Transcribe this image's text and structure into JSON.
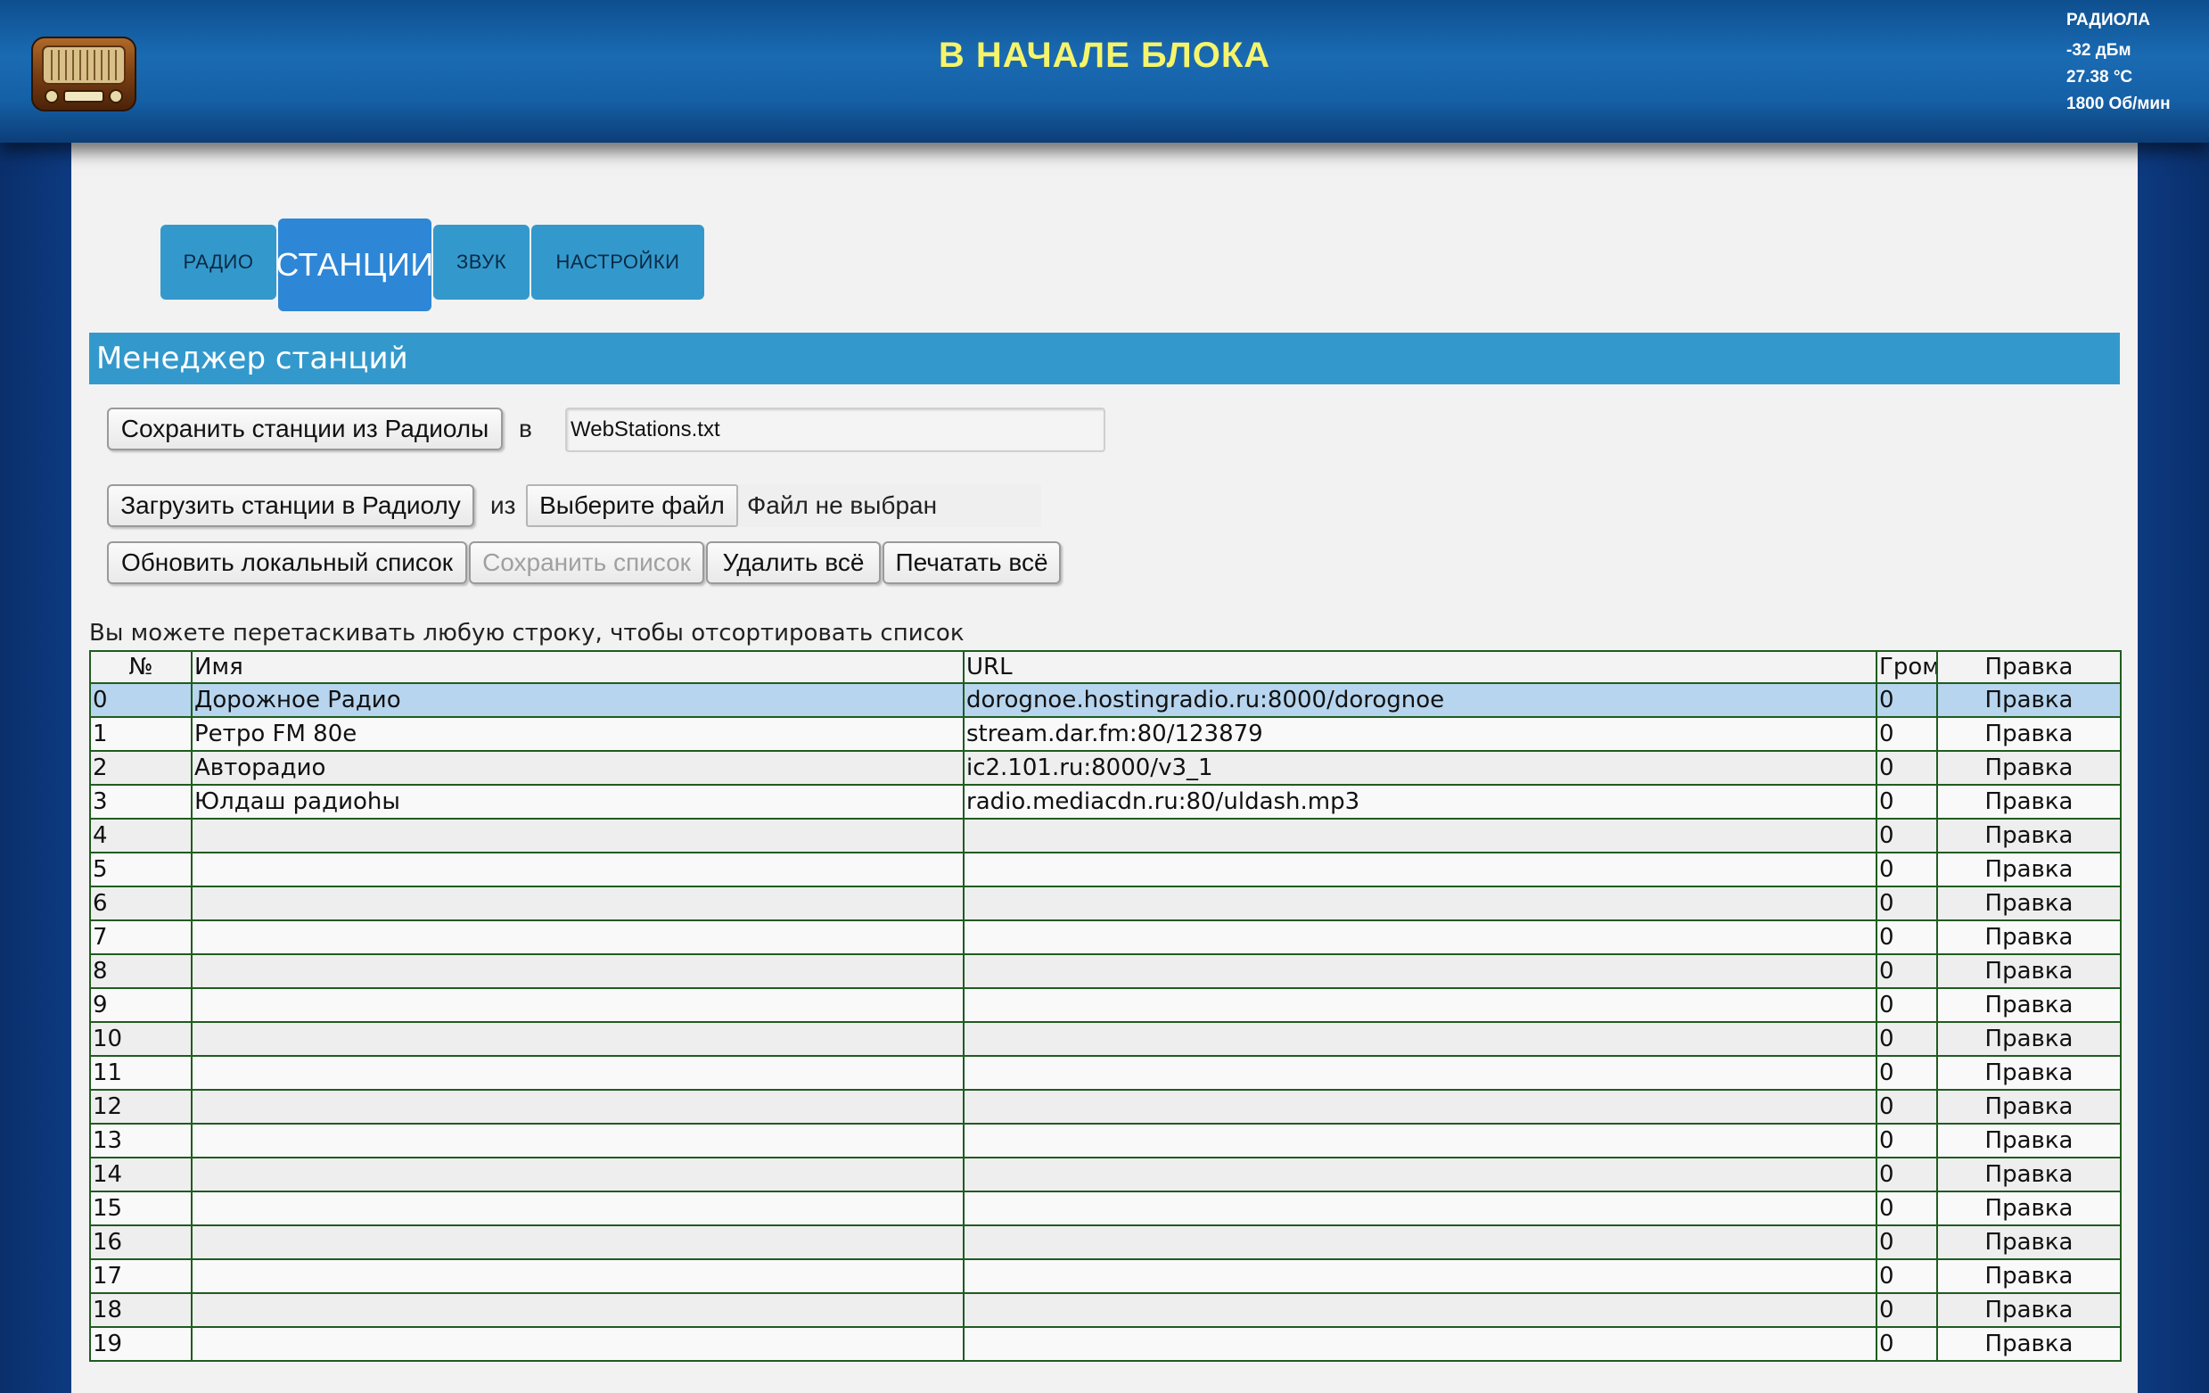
{
  "header": {
    "title": "В НАЧАЛЕ БЛОКА",
    "logo": "radio-logo",
    "status": {
      "name": "РАДИОЛА",
      "signal": "-32 дБм",
      "temperature": "27.38 °C",
      "fan": "1800 Об/мин"
    }
  },
  "tabs": [
    {
      "label": "РАДИО",
      "active": false
    },
    {
      "label": "СТАНЦИИ",
      "active": true
    },
    {
      "label": "ЗВУК",
      "active": false
    },
    {
      "label": "НАСТРОЙКИ",
      "active": false
    }
  ],
  "section": {
    "title": "Менеджер станций"
  },
  "save_row": {
    "button": "Сохранить станции из Радиолы",
    "to_label": "в",
    "filename_value": "WebStations.txt"
  },
  "load_row": {
    "button": "Загрузить станции в Радиолу",
    "from_label": "из",
    "choose_file": "Выберите файл",
    "no_file": "Файл не выбран"
  },
  "actions": {
    "refresh": "Обновить локальный список",
    "save_list": "Сохранить список",
    "delete_all": "Удалить всё",
    "print_all": "Печатать всё"
  },
  "hint": "Вы можете перетаскивать любую строку, чтобы отсортировать список",
  "table": {
    "headers": {
      "num": "№",
      "name": "Имя",
      "url": "URL",
      "volume": "Гром",
      "edit": "Правка"
    },
    "rows": [
      {
        "num": "0",
        "name": "Дорожное Радио",
        "url": "dorognoe.hostingradio.ru:8000/dorognoe",
        "volume": "0",
        "edit": "Правка"
      },
      {
        "num": "1",
        "name": "Ретро FM 80е",
        "url": "stream.dar.fm:80/123879",
        "volume": "0",
        "edit": "Правка"
      },
      {
        "num": "2",
        "name": "Авторадио",
        "url": "ic2.101.ru:8000/v3_1",
        "volume": "0",
        "edit": "Правка"
      },
      {
        "num": "3",
        "name": "Юлдаш радиоhы",
        "url": "radio.mediacdn.ru:80/uldash.mp3",
        "volume": "0",
        "edit": "Правка"
      },
      {
        "num": "4",
        "name": "",
        "url": "",
        "volume": "0",
        "edit": "Правка"
      },
      {
        "num": "5",
        "name": "",
        "url": "",
        "volume": "0",
        "edit": "Правка"
      },
      {
        "num": "6",
        "name": "",
        "url": "",
        "volume": "0",
        "edit": "Правка"
      },
      {
        "num": "7",
        "name": "",
        "url": "",
        "volume": "0",
        "edit": "Правка"
      },
      {
        "num": "8",
        "name": "",
        "url": "",
        "volume": "0",
        "edit": "Правка"
      },
      {
        "num": "9",
        "name": "",
        "url": "",
        "volume": "0",
        "edit": "Правка"
      },
      {
        "num": "10",
        "name": "",
        "url": "",
        "volume": "0",
        "edit": "Правка"
      },
      {
        "num": "11",
        "name": "",
        "url": "",
        "volume": "0",
        "edit": "Правка"
      },
      {
        "num": "12",
        "name": "",
        "url": "",
        "volume": "0",
        "edit": "Правка"
      },
      {
        "num": "13",
        "name": "",
        "url": "",
        "volume": "0",
        "edit": "Правка"
      },
      {
        "num": "14",
        "name": "",
        "url": "",
        "volume": "0",
        "edit": "Правка"
      },
      {
        "num": "15",
        "name": "",
        "url": "",
        "volume": "0",
        "edit": "Правка"
      },
      {
        "num": "16",
        "name": "",
        "url": "",
        "volume": "0",
        "edit": "Правка"
      },
      {
        "num": "17",
        "name": "",
        "url": "",
        "volume": "0",
        "edit": "Правка"
      },
      {
        "num": "18",
        "name": "",
        "url": "",
        "volume": "0",
        "edit": "Правка"
      },
      {
        "num": "19",
        "name": "",
        "url": "",
        "volume": "0",
        "edit": "Правка"
      }
    ]
  },
  "colors": {
    "header_title": "#f6f46a",
    "accent": "#3399cc",
    "active_tab": "#2e87d6",
    "selected_row": "#b7d5ee",
    "table_border": "#1f5c1f"
  }
}
